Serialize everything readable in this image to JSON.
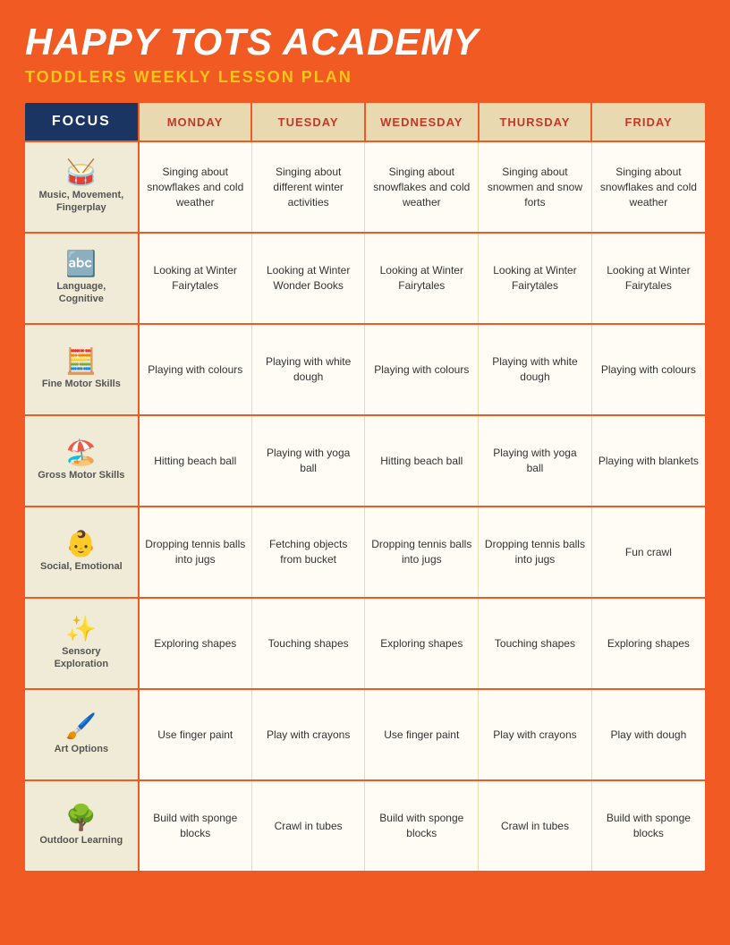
{
  "header": {
    "title": "HAPPY TOTS ACADEMY",
    "subtitle": "TODDLERS WEEKLY LESSON PLAN"
  },
  "table": {
    "columns": [
      "FOCUS",
      "MONDAY",
      "TUESDAY",
      "WEDNESDAY",
      "THURSDAY",
      "FRIDAY"
    ],
    "rows": [
      {
        "focus": {
          "label": "Music, Movement, Fingerplay",
          "icon": "🥁"
        },
        "monday": "Singing about snowflakes and cold weather",
        "tuesday": "Singing about different winter activities",
        "wednesday": "Singing about snowflakes and cold weather",
        "thursday": "Singing about snowmen and snow forts",
        "friday": "Singing about snowflakes and cold weather"
      },
      {
        "focus": {
          "label": "Language, Cognitive",
          "icon": "🔤"
        },
        "monday": "Looking at Winter Fairytales",
        "tuesday": "Looking at Winter Wonder Books",
        "wednesday": "Looking at Winter Fairytales",
        "thursday": "Looking at Winter Fairytales",
        "friday": "Looking at Winter Fairytales"
      },
      {
        "focus": {
          "label": "Fine Motor Skills",
          "icon": "🧮"
        },
        "monday": "Playing with colours",
        "tuesday": "Playing with white dough",
        "wednesday": "Playing with colours",
        "thursday": "Playing with white dough",
        "friday": "Playing with colours"
      },
      {
        "focus": {
          "label": "Gross Motor Skills",
          "icon": "🏖️"
        },
        "monday": "Hitting beach ball",
        "tuesday": "Playing with yoga ball",
        "wednesday": "Hitting beach ball",
        "thursday": "Playing with yoga ball",
        "friday": "Playing with blankets"
      },
      {
        "focus": {
          "label": "Social, Emotional",
          "icon": "👶"
        },
        "monday": "Dropping tennis balls into jugs",
        "tuesday": "Fetching objects from bucket",
        "wednesday": "Dropping tennis balls into jugs",
        "thursday": "Dropping tennis balls into jugs",
        "friday": "Fun crawl"
      },
      {
        "focus": {
          "label": "Sensory Exploration",
          "icon": "✨"
        },
        "monday": "Exploring shapes",
        "tuesday": "Touching shapes",
        "wednesday": "Exploring shapes",
        "thursday": "Touching shapes",
        "friday": "Exploring shapes"
      },
      {
        "focus": {
          "label": "Art Options",
          "icon": "🖌️"
        },
        "monday": "Use finger paint",
        "tuesday": "Play with crayons",
        "wednesday": "Use finger paint",
        "thursday": "Play with crayons",
        "friday": "Play with dough"
      },
      {
        "focus": {
          "label": "Outdoor Learning",
          "icon": "🌳"
        },
        "monday": "Build with sponge blocks",
        "tuesday": "Crawl in tubes",
        "wednesday": "Build with sponge blocks",
        "thursday": "Crawl in tubes",
        "friday": "Build with sponge blocks"
      }
    ]
  }
}
